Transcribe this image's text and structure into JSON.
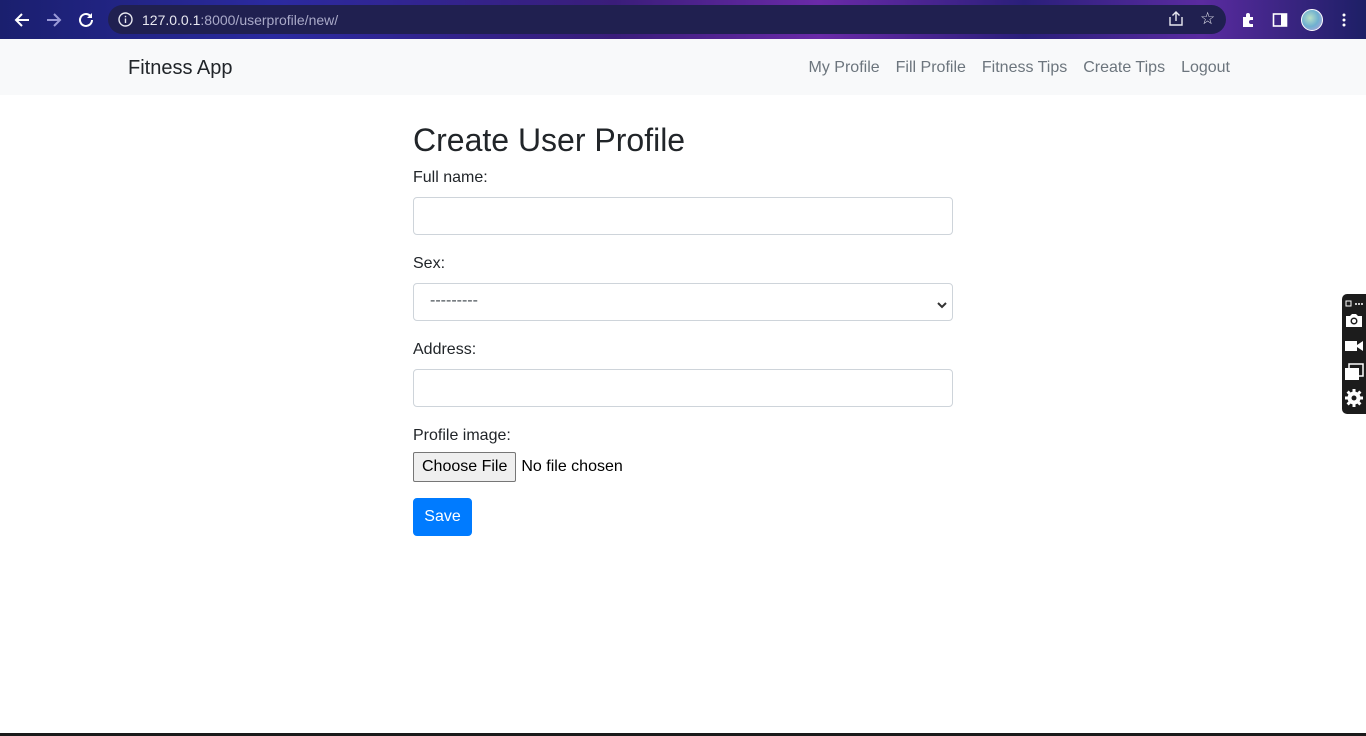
{
  "browser": {
    "url_host": "127.0.0.1",
    "url_path": ":8000/userprofile/new/",
    "back_icon": "arrow-left-icon",
    "forward_icon": "arrow-right-icon",
    "reload_icon": "reload-icon"
  },
  "navbar": {
    "brand": "Fitness App",
    "links": [
      "My Profile",
      "Fill Profile",
      "Fitness Tips",
      "Create Tips",
      "Logout"
    ]
  },
  "form": {
    "title": "Create User Profile",
    "full_name_label": "Full name:",
    "full_name_value": "",
    "sex_label": "Sex:",
    "sex_selected": "---------",
    "address_label": "Address:",
    "address_value": "",
    "image_label": "Profile image:",
    "file_button": "Choose File",
    "file_status": "No file chosen",
    "save_label": "Save"
  },
  "colors": {
    "primary": "#007bff",
    "navbar_bg": "#f8f9fa",
    "nav_link": "#6c757d"
  }
}
